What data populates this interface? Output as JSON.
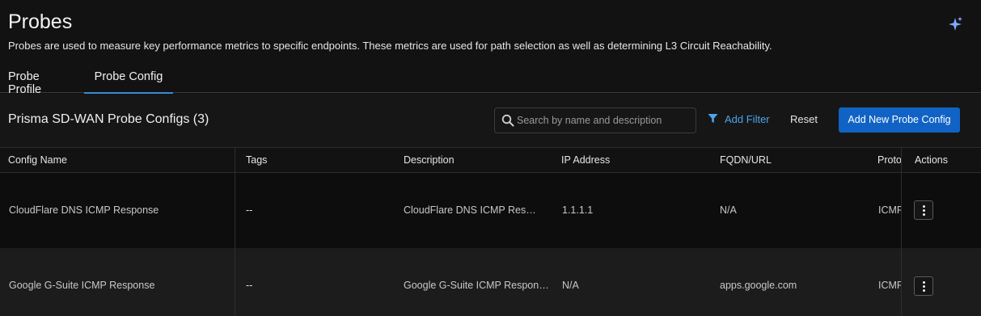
{
  "header": {
    "title": "Probes",
    "description": "Probes are used to measure key performance metrics to specific endpoints. These metrics are used for path selection as well as determining L3 Circuit Reachability."
  },
  "tabs": [
    {
      "label": "Probe Profile",
      "active": false
    },
    {
      "label": "Probe Config",
      "active": true
    }
  ],
  "toolbar": {
    "table_title": "Prisma SD-WAN Probe Configs (3)",
    "search_placeholder": "Search by name and description",
    "search_value": "",
    "filter_label": "Add Filter",
    "reset_label": "Reset",
    "add_label": "Add New Probe Config"
  },
  "table": {
    "columns": [
      "Config Name",
      "Tags",
      "Description",
      "IP Address",
      "FQDN/URL",
      "Proto",
      "Actions"
    ],
    "rows": [
      {
        "name": "CloudFlare DNS ICMP Response",
        "tags": "--",
        "description": "CloudFlare DNS ICMP Respo...",
        "ip": "1.1.1.1",
        "fqdn": "N/A",
        "proto": "ICMP"
      },
      {
        "name": "Google G-Suite ICMP Response",
        "tags": "--",
        "description": "Google G-Suite ICMP Response",
        "ip": "N/A",
        "fqdn": "apps.google.com",
        "proto": "ICMP"
      }
    ]
  },
  "colors": {
    "accent": "#1063c4",
    "link": "#4ea3ec",
    "tab_indicator": "#3a8ad4",
    "sparkle": "#7fa8ff"
  },
  "icons": [
    "sparkle-icon",
    "search-icon",
    "filter-icon",
    "kebab-icon"
  ]
}
